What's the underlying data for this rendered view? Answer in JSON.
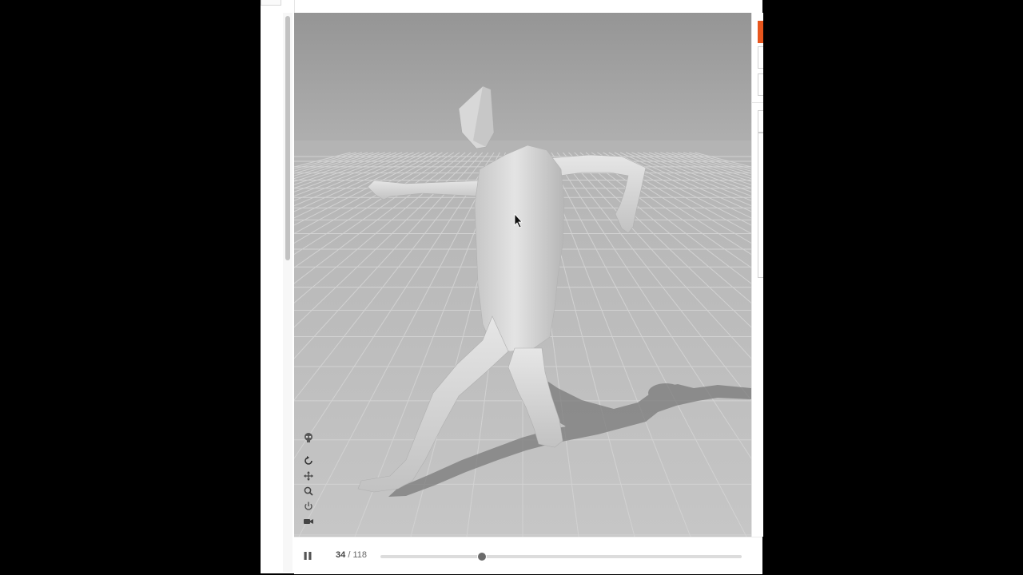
{
  "viewer": {
    "playback": {
      "current_frame": "34",
      "separator": "/",
      "total_frames": "118",
      "progress_fraction": 0.28,
      "state": "playing"
    },
    "toolbar_icons": [
      "skeleton-icon",
      "reset-view-icon",
      "pan-icon",
      "zoom-icon",
      "power-icon",
      "camera-icon"
    ]
  },
  "colors": {
    "accent": "#e8561d",
    "floor": "#bdbdbd",
    "sky": "#9c9c9c",
    "model": "#d4d4d4"
  }
}
